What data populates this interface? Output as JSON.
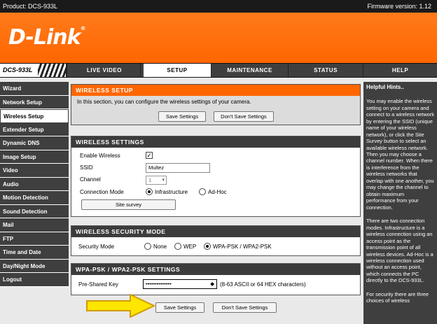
{
  "topbar": {
    "product": "Product: DCS-933L",
    "firmware": "Firmware version: 1.12"
  },
  "header": {
    "logo": "D-Link",
    "logo_mark": "®"
  },
  "nav": {
    "model": "DCS-933L",
    "tabs": [
      {
        "label": "LIVE VIDEO"
      },
      {
        "label": "SETUP"
      },
      {
        "label": "MAINTENANCE"
      },
      {
        "label": "STATUS"
      },
      {
        "label": "HELP"
      }
    ]
  },
  "sidebar": {
    "items": [
      {
        "label": "Wizard"
      },
      {
        "label": "Network Setup"
      },
      {
        "label": "Wireless Setup"
      },
      {
        "label": "Extender Setup"
      },
      {
        "label": "Dynamic DNS"
      },
      {
        "label": "Image Setup"
      },
      {
        "label": "Video"
      },
      {
        "label": "Audio"
      },
      {
        "label": "Motion Detection"
      },
      {
        "label": "Sound Detection"
      },
      {
        "label": "Mail"
      },
      {
        "label": "FTP"
      },
      {
        "label": "Time and Date"
      },
      {
        "label": "Day/Night Mode"
      },
      {
        "label": "Logout"
      }
    ],
    "active_index": 2
  },
  "wireless_setup": {
    "title": "WIRELESS SETUP",
    "description": "In this section, you can configure the wireless settings of your camera.",
    "save_label": "Save Settings",
    "dont_save_label": "Don't Save Settings"
  },
  "wireless_settings": {
    "title": "WIRELESS SETTINGS",
    "enable_label": "Enable Wireless",
    "enable_checked": "✓",
    "ssid_label": "SSID",
    "ssid_value": "Multez",
    "channel_label": "Channel",
    "channel_value": "1",
    "mode_label": "Connection Mode",
    "mode_infra": "Infrastructure",
    "mode_adhoc": "Ad-Hoc",
    "survey_label": "Site survey"
  },
  "security": {
    "title": "WIRELESS SECURITY MODE",
    "mode_label": "Security Mode",
    "opt_none": "None",
    "opt_wep": "WEP",
    "opt_wpa": "WPA-PSK / WPA2-PSK"
  },
  "wpa": {
    "title": "WPA-PSK / WPA2-PSK SETTINGS",
    "psk_label": "Pre-Shared Key",
    "psk_value": "••••••••••••••",
    "psk_hint": "(8-63 ASCII or 64 HEX characters)",
    "save_label": "Save Settings",
    "dont_save_label": "Don't Save Settings"
  },
  "hints": {
    "title": "Helpful Hints..",
    "p1": "You may enable the wireless setting on your camera and connect to a wireless network by entering the SSID (unique name of your wireless network), or click the Site Survey button to select an available wireless network. Then you may choose a channel number. When there is interference from the wireless networks that overlap with one another, you may change the channel to obtain maximum performance from your connection.",
    "p2": "There are two connection modes. Infrastructure is a wireless connection using an access point as the transmission point of all wireless devices. Ad-Hoc is a wireless connection used without an access point, which connects the PC directly to the DCS-933L.",
    "p3": "For security there are three choices of wireless"
  },
  "colors": {
    "brand": "#ff6600",
    "nav": "#3f3f3f",
    "arrow": "#ffe600"
  }
}
